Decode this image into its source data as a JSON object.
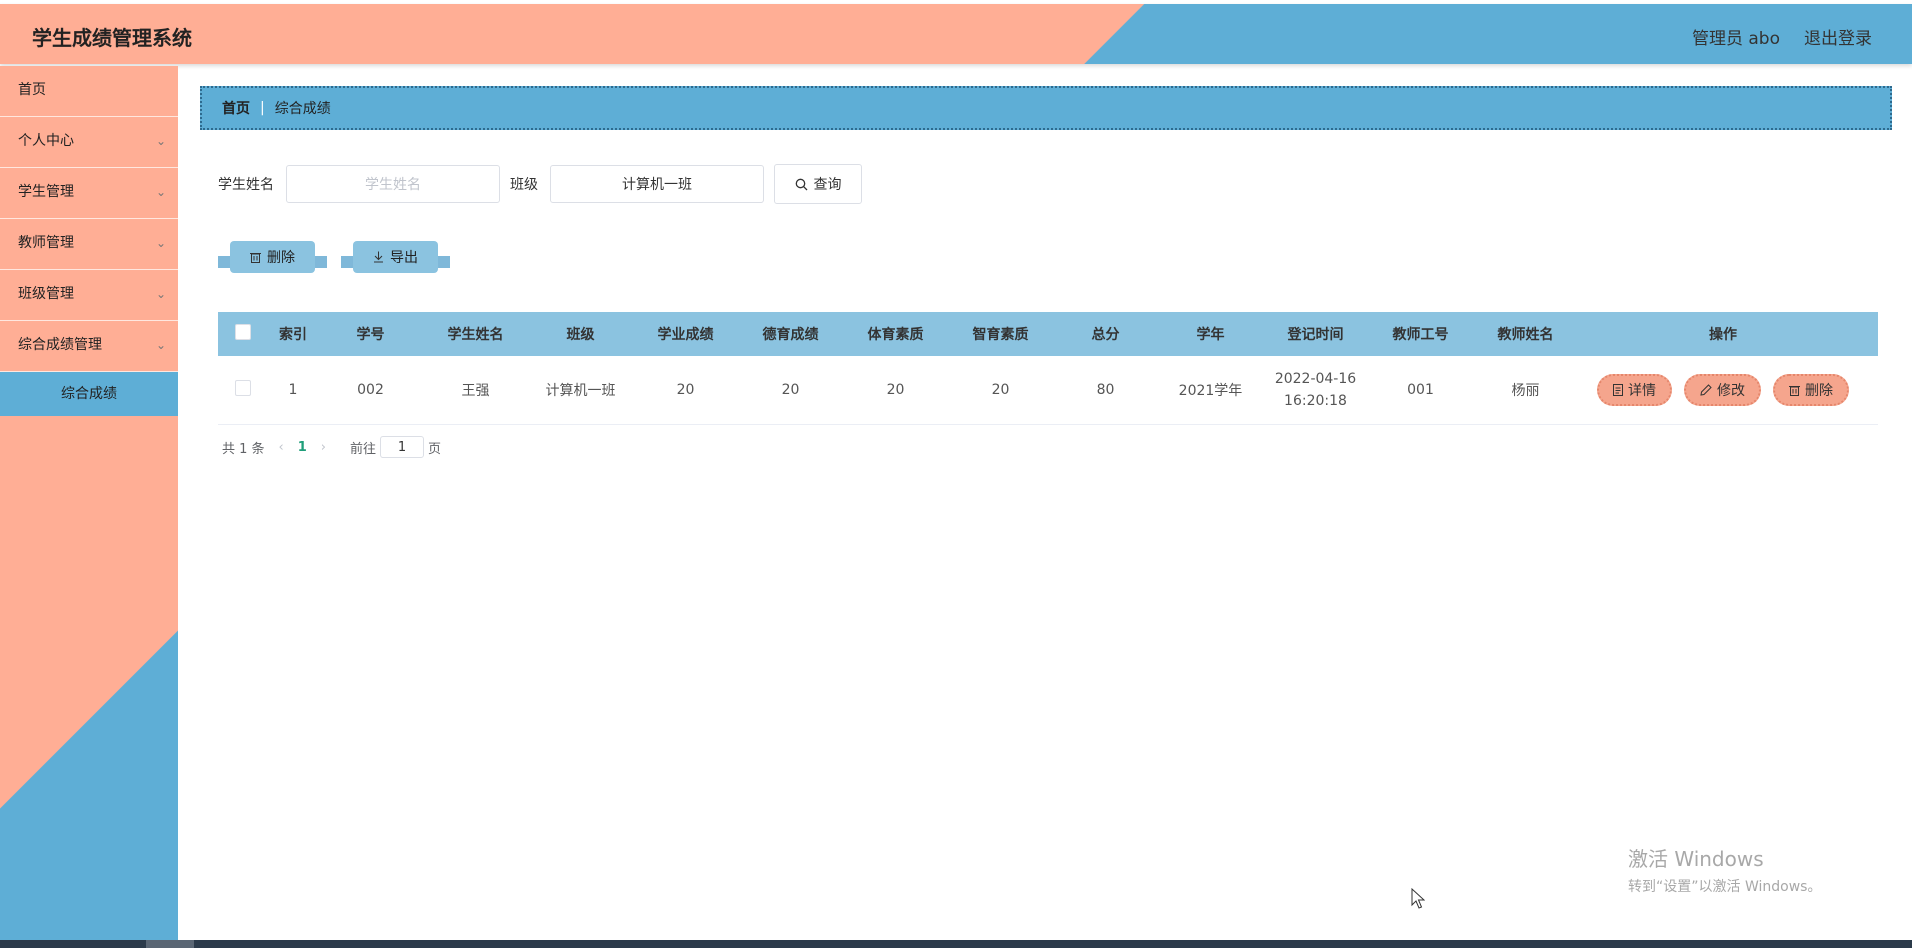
{
  "header": {
    "title": "学生成绩管理系统",
    "user": "管理员 abo",
    "logout": "退出登录"
  },
  "sidebar": {
    "items": [
      {
        "label": "首页",
        "has_sub": false
      },
      {
        "label": "个人中心",
        "has_sub": true
      },
      {
        "label": "学生管理",
        "has_sub": true
      },
      {
        "label": "教师管理",
        "has_sub": true
      },
      {
        "label": "班级管理",
        "has_sub": true
      },
      {
        "label": "综合成绩管理",
        "has_sub": true
      }
    ],
    "sub_active": "综合成绩"
  },
  "breadcrumb": {
    "home": "首页",
    "separator": "|",
    "current": "综合成绩"
  },
  "search": {
    "name_label": "学生姓名",
    "name_placeholder": "学生姓名",
    "class_label": "班级",
    "class_value": "计算机一班",
    "query_button": "查询"
  },
  "actions": {
    "delete": "删除",
    "export": "导出"
  },
  "table": {
    "headers": [
      "索引",
      "学号",
      "学生姓名",
      "班级",
      "学业成绩",
      "德育成绩",
      "体育素质",
      "智育素质",
      "总分",
      "学年",
      "登记时间",
      "教师工号",
      "教师姓名",
      "操作"
    ],
    "rows": [
      {
        "index": "1",
        "student_no": "002",
        "name": "王强",
        "class": "计算机一班",
        "academic": "20",
        "moral": "20",
        "physical": "20",
        "intellectual": "20",
        "total": "80",
        "year": "2021学年",
        "reg_date": "2022-04-16",
        "reg_time": "16:20:18",
        "teacher_no": "001",
        "teacher_name": "杨丽"
      }
    ],
    "ops": {
      "detail": "详情",
      "edit": "修改",
      "delete": "删除"
    }
  },
  "pagination": {
    "total": "共 1 条",
    "prev": "‹",
    "current": "1",
    "next": "›",
    "goto": "前往",
    "page_value": "1",
    "page_unit": "页"
  },
  "watermark": {
    "line1": "激活 Windows",
    "line2": "转到“设置”以激活 Windows。"
  },
  "colors": {
    "salmon": "#ffae95",
    "blue": "#5eaed6",
    "light_blue": "#8bc3e0",
    "op_button": "#f5a58d"
  },
  "icons": [
    "search-icon",
    "trash-icon",
    "download-icon",
    "document-icon",
    "edit-icon",
    "chevron-down-icon",
    "mouse-cursor-icon"
  ]
}
